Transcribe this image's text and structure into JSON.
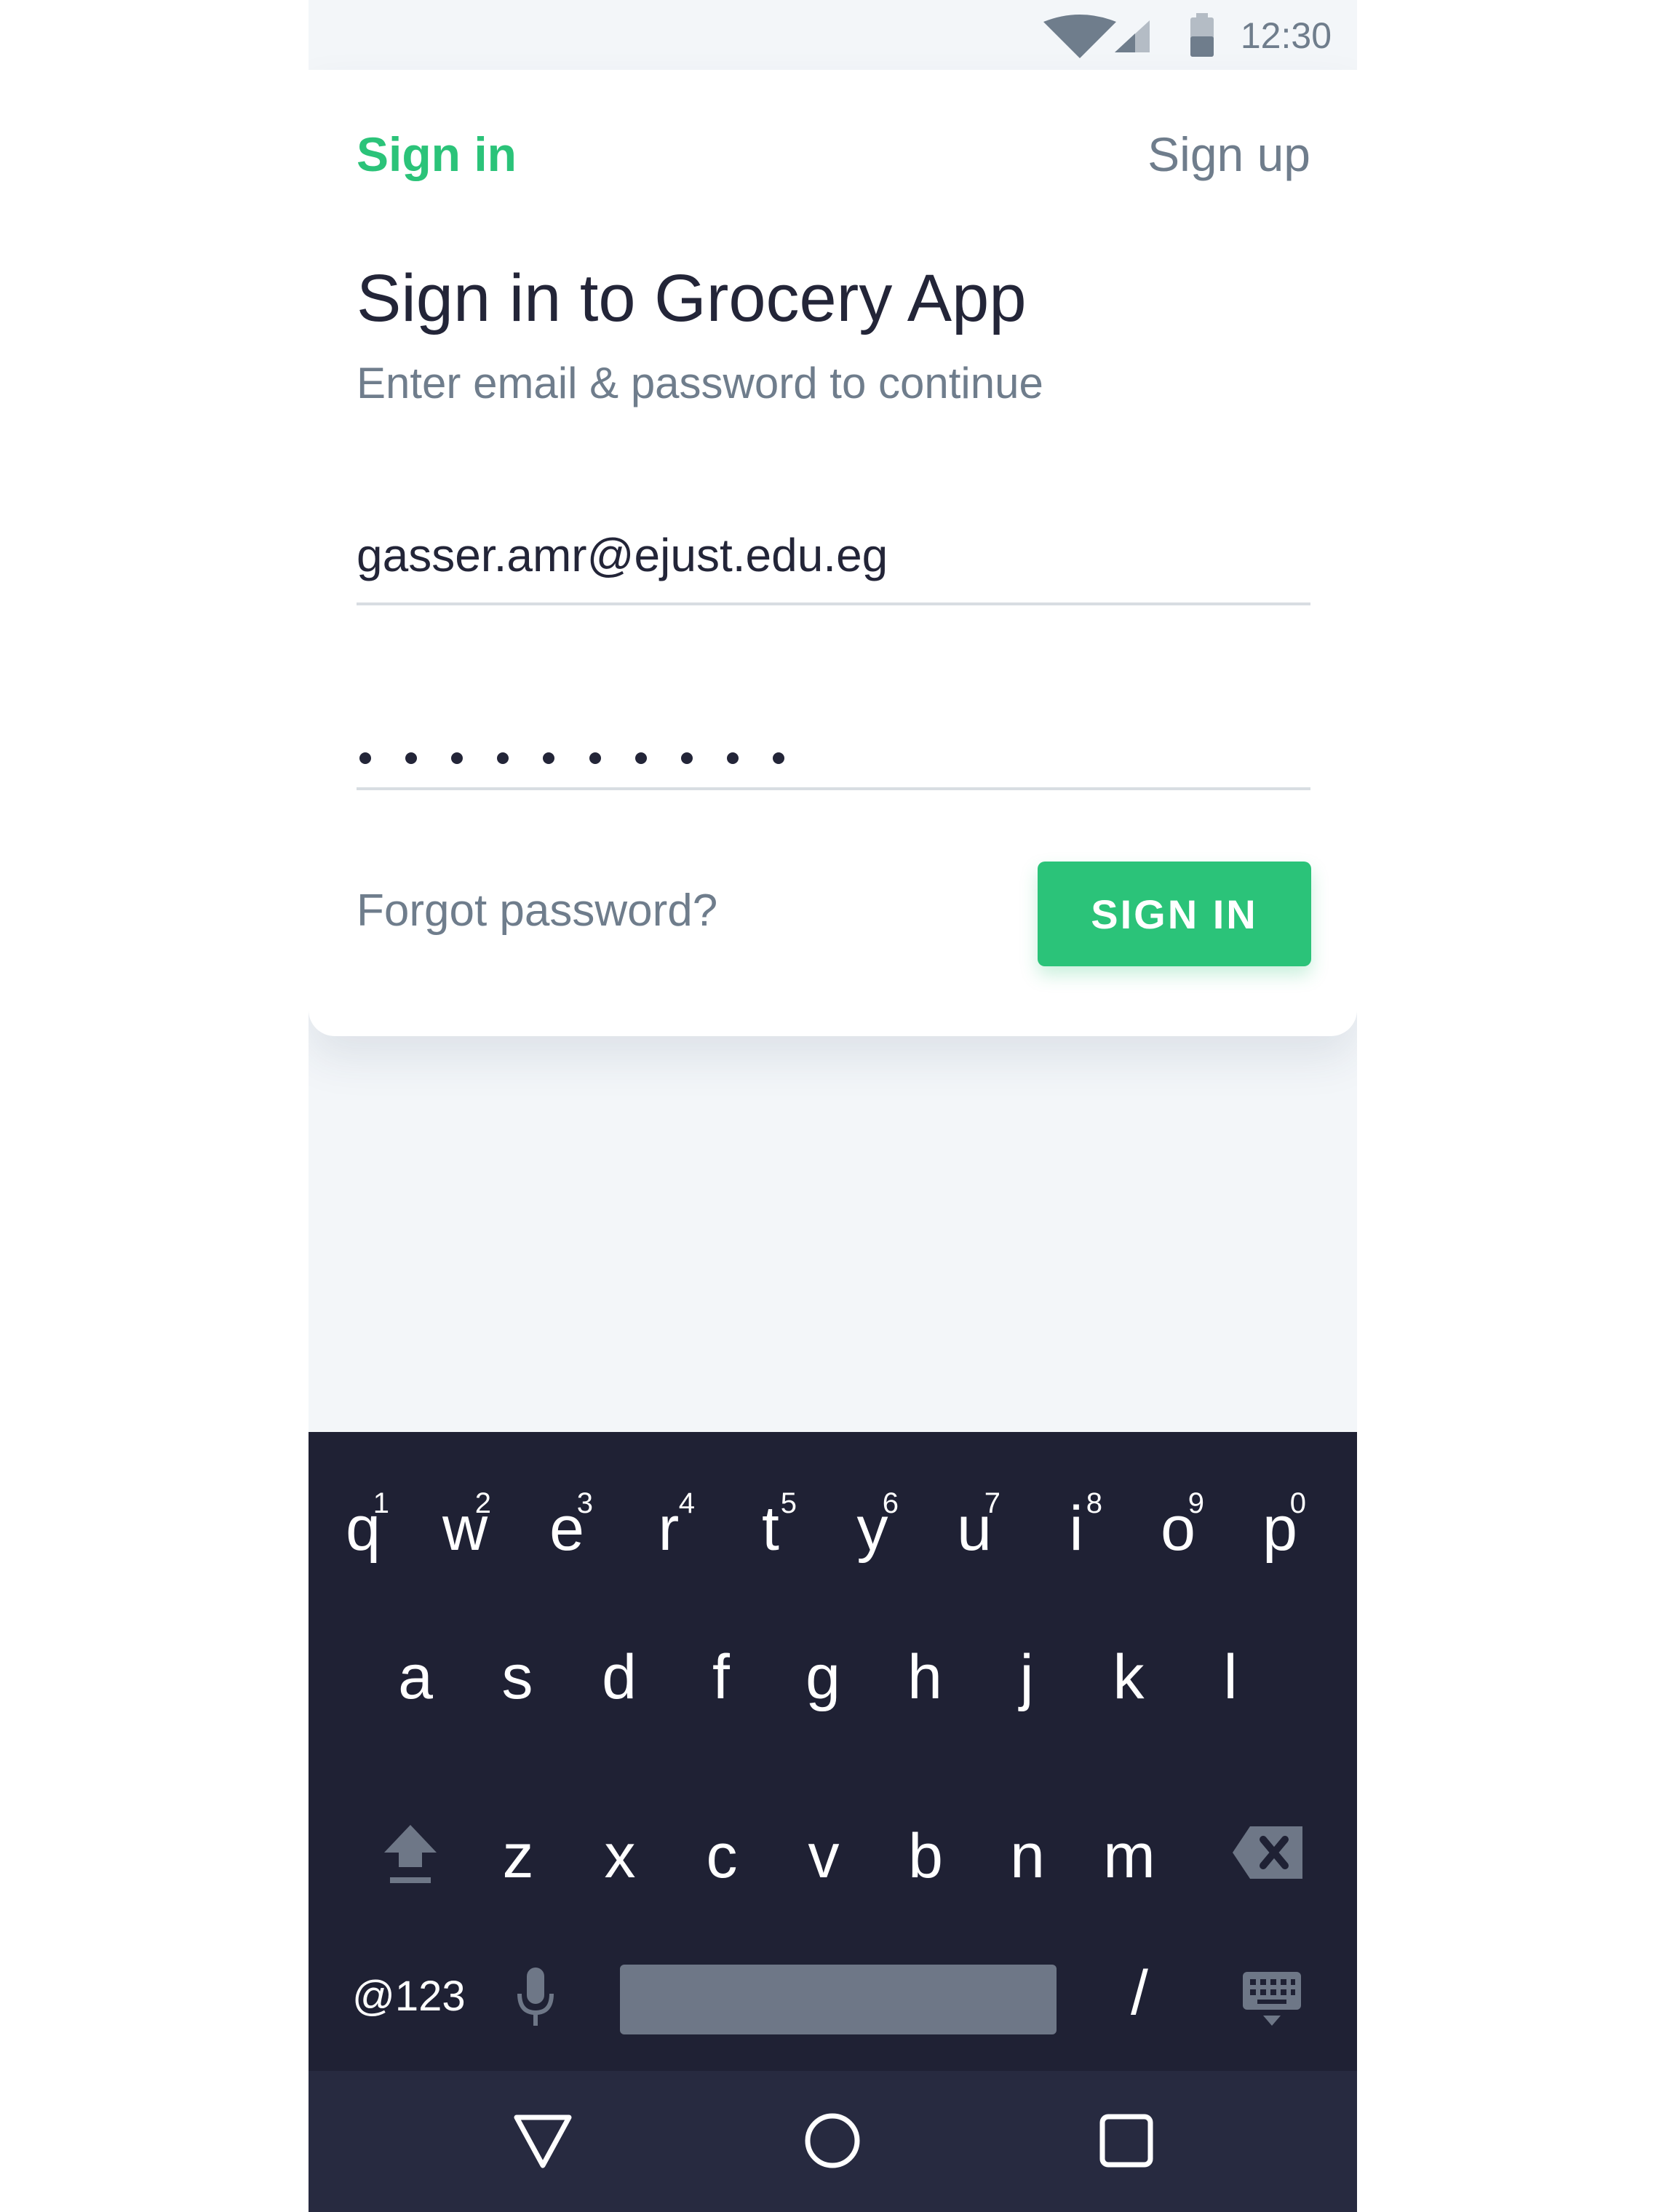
{
  "status_bar": {
    "time": "12:30",
    "icons": [
      "wifi-icon",
      "cellular-signal-icon",
      "battery-icon"
    ]
  },
  "tabs": {
    "sign_in": "Sign in",
    "sign_up": "Sign up"
  },
  "header": {
    "title": "Sign in to Grocery App",
    "subtitle": "Enter email & password to continue"
  },
  "form": {
    "email_value": "gasser.amr@ejust.edu.eg",
    "password_mask": "••••••••••",
    "forgot_label": "Forgot password?",
    "submit_label": "SIGN IN"
  },
  "keyboard": {
    "row1": [
      {
        "key": "q",
        "hint": "1"
      },
      {
        "key": "w",
        "hint": "2"
      },
      {
        "key": "e",
        "hint": "3"
      },
      {
        "key": "r",
        "hint": "4"
      },
      {
        "key": "t",
        "hint": "5"
      },
      {
        "key": "y",
        "hint": "6"
      },
      {
        "key": "u",
        "hint": "7"
      },
      {
        "key": "i",
        "hint": "8"
      },
      {
        "key": "o",
        "hint": "9"
      },
      {
        "key": "p",
        "hint": "0"
      }
    ],
    "row2": [
      "a",
      "s",
      "d",
      "f",
      "g",
      "h",
      "j",
      "k",
      "l"
    ],
    "row3": [
      "z",
      "x",
      "c",
      "v",
      "b",
      "n",
      "m"
    ],
    "symbols_label": "@123",
    "slash_label": "/"
  },
  "nav_bar": {
    "icons": [
      "back-triangle-icon",
      "home-circle-icon",
      "recents-square-icon"
    ]
  },
  "colors": {
    "accent": "#2bc379",
    "text_dark": "#232538",
    "text_muted": "#6f7d8c",
    "keyboard_bg": "#1f2134",
    "nav_bg": "#272a40"
  }
}
